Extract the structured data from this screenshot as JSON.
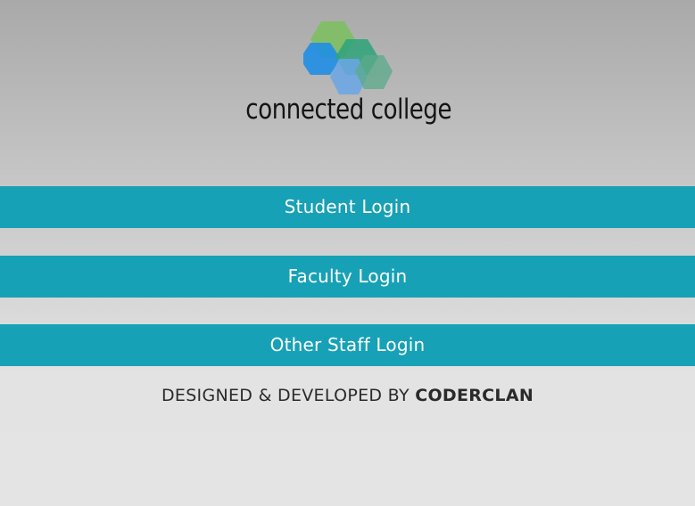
{
  "logo": {
    "icon": "hexagon-cluster-logo-icon",
    "text": "connected college",
    "colors": [
      "#7bbf5e",
      "#1f8ee6",
      "#2ea37a",
      "#6aa6e6"
    ]
  },
  "buttons": {
    "student": "Student Login",
    "faculty": "Faculty Login",
    "staff": "Other Staff Login"
  },
  "footer": {
    "prefix": "DESIGNED & DEVELOPED BY ",
    "brand": "CODERCLAN"
  },
  "colors": {
    "button_background": "#17a1b6",
    "button_text": "#ffffff"
  }
}
